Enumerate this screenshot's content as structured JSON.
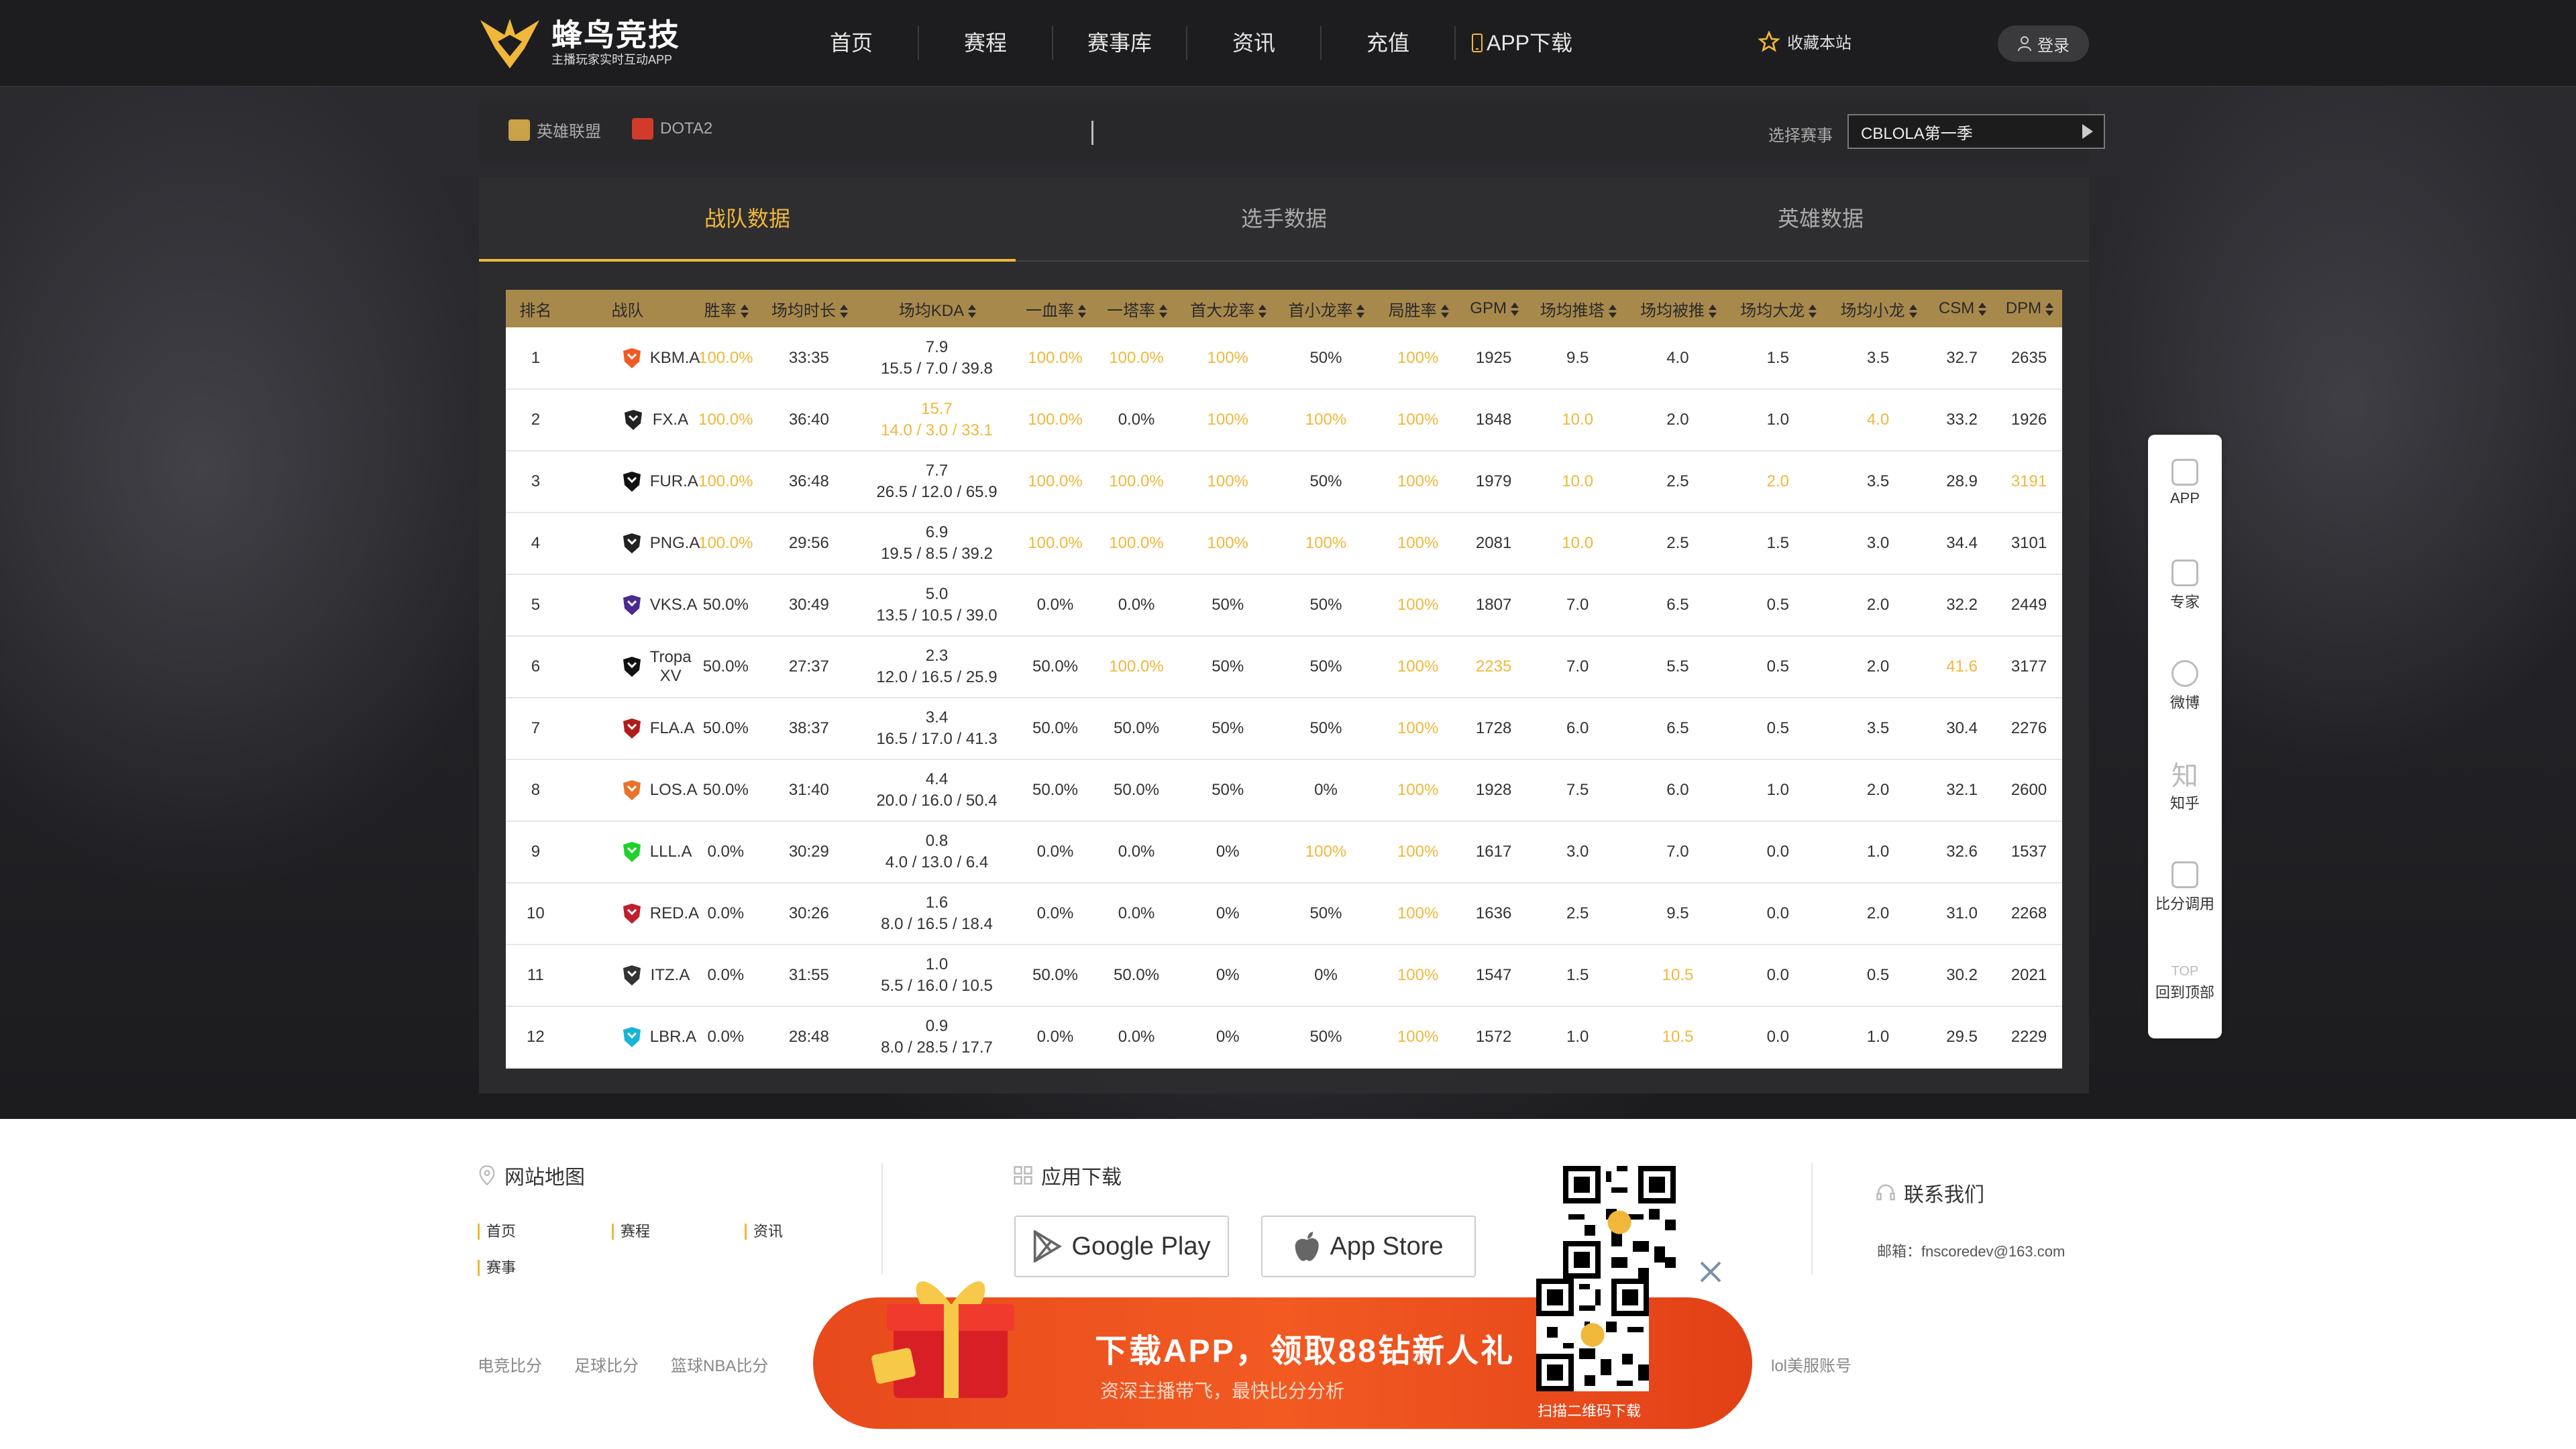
{
  "brand": {
    "title": "蜂鸟竞技",
    "subtitle": "主播玩家实时互动APP"
  },
  "nav": {
    "items": [
      "首页",
      "赛程",
      "赛事库",
      "资讯",
      "充值"
    ],
    "app_download": "APP下载",
    "favorite": "收藏本站",
    "login": "登录"
  },
  "game_bar": {
    "games": [
      "英雄联盟",
      "DOTA2"
    ],
    "select_label": "选择赛事",
    "selected_event": "CBLOLA第一季"
  },
  "tabs": [
    "战队数据",
    "选手数据",
    "英雄数据"
  ],
  "active_tab": 0,
  "table": {
    "columns": [
      "排名",
      "战队",
      "胜率",
      "场均时长",
      "场均KDA",
      "一血率",
      "一塔率",
      "首大龙率",
      "首小龙率",
      "局胜率",
      "GPM",
      "场均推塔",
      "场均被推",
      "场均大龙",
      "场均小龙",
      "CSM",
      "DPM"
    ],
    "rows": [
      {
        "rank": "1",
        "team": "KBM.A",
        "win": "100.0%",
        "dur": "33:35",
        "kda": "7.9",
        "kda_detail": "15.5 / 7.0 / 39.8",
        "fb": "100.0%",
        "ft": "100.0%",
        "fbaron": "100%",
        "fdrag": "50%",
        "gw": "100%",
        "gpm": "1925",
        "tp": "9.5",
        "tl": "4.0",
        "baron": "1.5",
        "drag": "3.5",
        "csm": "32.7",
        "dpm": "2635",
        "gold": [
          "win",
          "fb",
          "ft",
          "fbaron",
          "gw"
        ]
      },
      {
        "rank": "2",
        "team": "FX.A",
        "win": "100.0%",
        "dur": "36:40",
        "kda": "15.7",
        "kda_detail": "14.0 / 3.0 / 33.1",
        "fb": "100.0%",
        "ft": "0.0%",
        "fbaron": "100%",
        "fdrag": "100%",
        "gw": "100%",
        "gpm": "1848",
        "tp": "10.0",
        "tl": "2.0",
        "baron": "1.0",
        "drag": "4.0",
        "csm": "33.2",
        "dpm": "1926",
        "gold": [
          "win",
          "kda",
          "fb",
          "fbaron",
          "fdrag",
          "gw",
          "tp",
          "drag"
        ]
      },
      {
        "rank": "3",
        "team": "FUR.A",
        "win": "100.0%",
        "dur": "36:48",
        "kda": "7.7",
        "kda_detail": "26.5 / 12.0 / 65.9",
        "fb": "100.0%",
        "ft": "100.0%",
        "fbaron": "100%",
        "fdrag": "50%",
        "gw": "100%",
        "gpm": "1979",
        "tp": "10.0",
        "tl": "2.5",
        "baron": "2.0",
        "drag": "3.5",
        "csm": "28.9",
        "dpm": "3191",
        "gold": [
          "win",
          "fb",
          "ft",
          "fbaron",
          "gw",
          "tp",
          "baron",
          "dpm"
        ]
      },
      {
        "rank": "4",
        "team": "PNG.A",
        "win": "100.0%",
        "dur": "29:56",
        "kda": "6.9",
        "kda_detail": "19.5 / 8.5 / 39.2",
        "fb": "100.0%",
        "ft": "100.0%",
        "fbaron": "100%",
        "fdrag": "100%",
        "gw": "100%",
        "gpm": "2081",
        "tp": "10.0",
        "tl": "2.5",
        "baron": "1.5",
        "drag": "3.0",
        "csm": "34.4",
        "dpm": "3101",
        "gold": [
          "win",
          "fb",
          "ft",
          "fbaron",
          "fdrag",
          "gw",
          "tp"
        ]
      },
      {
        "rank": "5",
        "team": "VKS.A",
        "win": "50.0%",
        "dur": "30:49",
        "kda": "5.0",
        "kda_detail": "13.5 / 10.5 / 39.0",
        "fb": "0.0%",
        "ft": "0.0%",
        "fbaron": "50%",
        "fdrag": "50%",
        "gw": "100%",
        "gpm": "1807",
        "tp": "7.0",
        "tl": "6.5",
        "baron": "0.5",
        "drag": "2.0",
        "csm": "32.2",
        "dpm": "2449",
        "gold": [
          "gw"
        ]
      },
      {
        "rank": "6",
        "team": "Tropa XV",
        "win": "50.0%",
        "dur": "27:37",
        "kda": "2.3",
        "kda_detail": "12.0 / 16.5 / 25.9",
        "fb": "50.0%",
        "ft": "100.0%",
        "fbaron": "50%",
        "fdrag": "50%",
        "gw": "100%",
        "gpm": "2235",
        "tp": "7.0",
        "tl": "5.5",
        "baron": "0.5",
        "drag": "2.0",
        "csm": "41.6",
        "dpm": "3177",
        "gold": [
          "ft",
          "gw",
          "gpm",
          "csm"
        ]
      },
      {
        "rank": "7",
        "team": "FLA.A",
        "win": "50.0%",
        "dur": "38:37",
        "kda": "3.4",
        "kda_detail": "16.5 / 17.0 / 41.3",
        "fb": "50.0%",
        "ft": "50.0%",
        "fbaron": "50%",
        "fdrag": "50%",
        "gw": "100%",
        "gpm": "1728",
        "tp": "6.0",
        "tl": "6.5",
        "baron": "0.5",
        "drag": "3.5",
        "csm": "30.4",
        "dpm": "2276",
        "gold": [
          "gw"
        ]
      },
      {
        "rank": "8",
        "team": "LOS.A",
        "win": "50.0%",
        "dur": "31:40",
        "kda": "4.4",
        "kda_detail": "20.0 / 16.0 / 50.4",
        "fb": "50.0%",
        "ft": "50.0%",
        "fbaron": "50%",
        "fdrag": "0%",
        "gw": "100%",
        "gpm": "1928",
        "tp": "7.5",
        "tl": "6.0",
        "baron": "1.0",
        "drag": "2.0",
        "csm": "32.1",
        "dpm": "2600",
        "gold": [
          "gw"
        ]
      },
      {
        "rank": "9",
        "team": "LLL.A",
        "win": "0.0%",
        "dur": "30:29",
        "kda": "0.8",
        "kda_detail": "4.0 / 13.0 / 6.4",
        "fb": "0.0%",
        "ft": "0.0%",
        "fbaron": "0%",
        "fdrag": "100%",
        "gw": "100%",
        "gpm": "1617",
        "tp": "3.0",
        "tl": "7.0",
        "baron": "0.0",
        "drag": "1.0",
        "csm": "32.6",
        "dpm": "1537",
        "gold": [
          "fdrag",
          "gw"
        ]
      },
      {
        "rank": "10",
        "team": "RED.A",
        "win": "0.0%",
        "dur": "30:26",
        "kda": "1.6",
        "kda_detail": "8.0 / 16.5 / 18.4",
        "fb": "0.0%",
        "ft": "0.0%",
        "fbaron": "0%",
        "fdrag": "50%",
        "gw": "100%",
        "gpm": "1636",
        "tp": "2.5",
        "tl": "9.5",
        "baron": "0.0",
        "drag": "2.0",
        "csm": "31.0",
        "dpm": "2268",
        "gold": [
          "gw"
        ]
      },
      {
        "rank": "11",
        "team": "ITZ.A",
        "win": "0.0%",
        "dur": "31:55",
        "kda": "1.0",
        "kda_detail": "5.5 / 16.0 / 10.5",
        "fb": "50.0%",
        "ft": "50.0%",
        "fbaron": "0%",
        "fdrag": "0%",
        "gw": "100%",
        "gpm": "1547",
        "tp": "1.5",
        "tl": "10.5",
        "baron": "0.0",
        "drag": "0.5",
        "csm": "30.2",
        "dpm": "2021",
        "gold": [
          "gw",
          "tl"
        ]
      },
      {
        "rank": "12",
        "team": "LBR.A",
        "win": "0.0%",
        "dur": "28:48",
        "kda": "0.9",
        "kda_detail": "8.0 / 28.5 / 17.7",
        "fb": "0.0%",
        "ft": "0.0%",
        "fbaron": "0%",
        "fdrag": "50%",
        "gw": "100%",
        "gpm": "1572",
        "tp": "1.0",
        "tl": "10.5",
        "baron": "0.0",
        "drag": "1.0",
        "csm": "29.5",
        "dpm": "2229",
        "gold": [
          "gw",
          "tl"
        ]
      }
    ]
  },
  "team_logo_colors": {
    "KBM.A": "#f05a22",
    "FX.A": "#222222",
    "FUR.A": "#111111",
    "PNG.A": "#222222",
    "VKS.A": "#4b2b8f",
    "Tropa XV": "#111111",
    "FLA.A": "#b01c1c",
    "LOS.A": "#e8742a",
    "LLL.A": "#1fd12c",
    "RED.A": "#c01f2f",
    "ITZ.A": "#333333",
    "LBR.A": "#19b3d6"
  },
  "sidebar": [
    "APP",
    "专家",
    "微博",
    "知乎",
    "比分调用",
    "回到顶部"
  ],
  "sidebar_top": "TOP",
  "footer": {
    "sitemap_title": "网站地图",
    "sitemap_links": [
      "首页",
      "赛程",
      "资讯",
      "赛事"
    ],
    "app_title": "应用下载",
    "google_play": "Google Play",
    "app_store": "App Store",
    "contact_title": "联系我们",
    "email": "邮箱：fnscoredev@163.com",
    "bottom_links": [
      "电竞比分",
      "足球比分",
      "篮球NBA比分",
      "lol美服账号"
    ]
  },
  "promo": {
    "title": "下载APP，领取88钻新人礼",
    "subtitle": "资深主播带飞，最快比分分析",
    "qr_label": "扫描二维码下载"
  },
  "colors": {
    "accent": "#f0b73a",
    "header_bg": "#a8894c",
    "promo": "#f25a22"
  }
}
